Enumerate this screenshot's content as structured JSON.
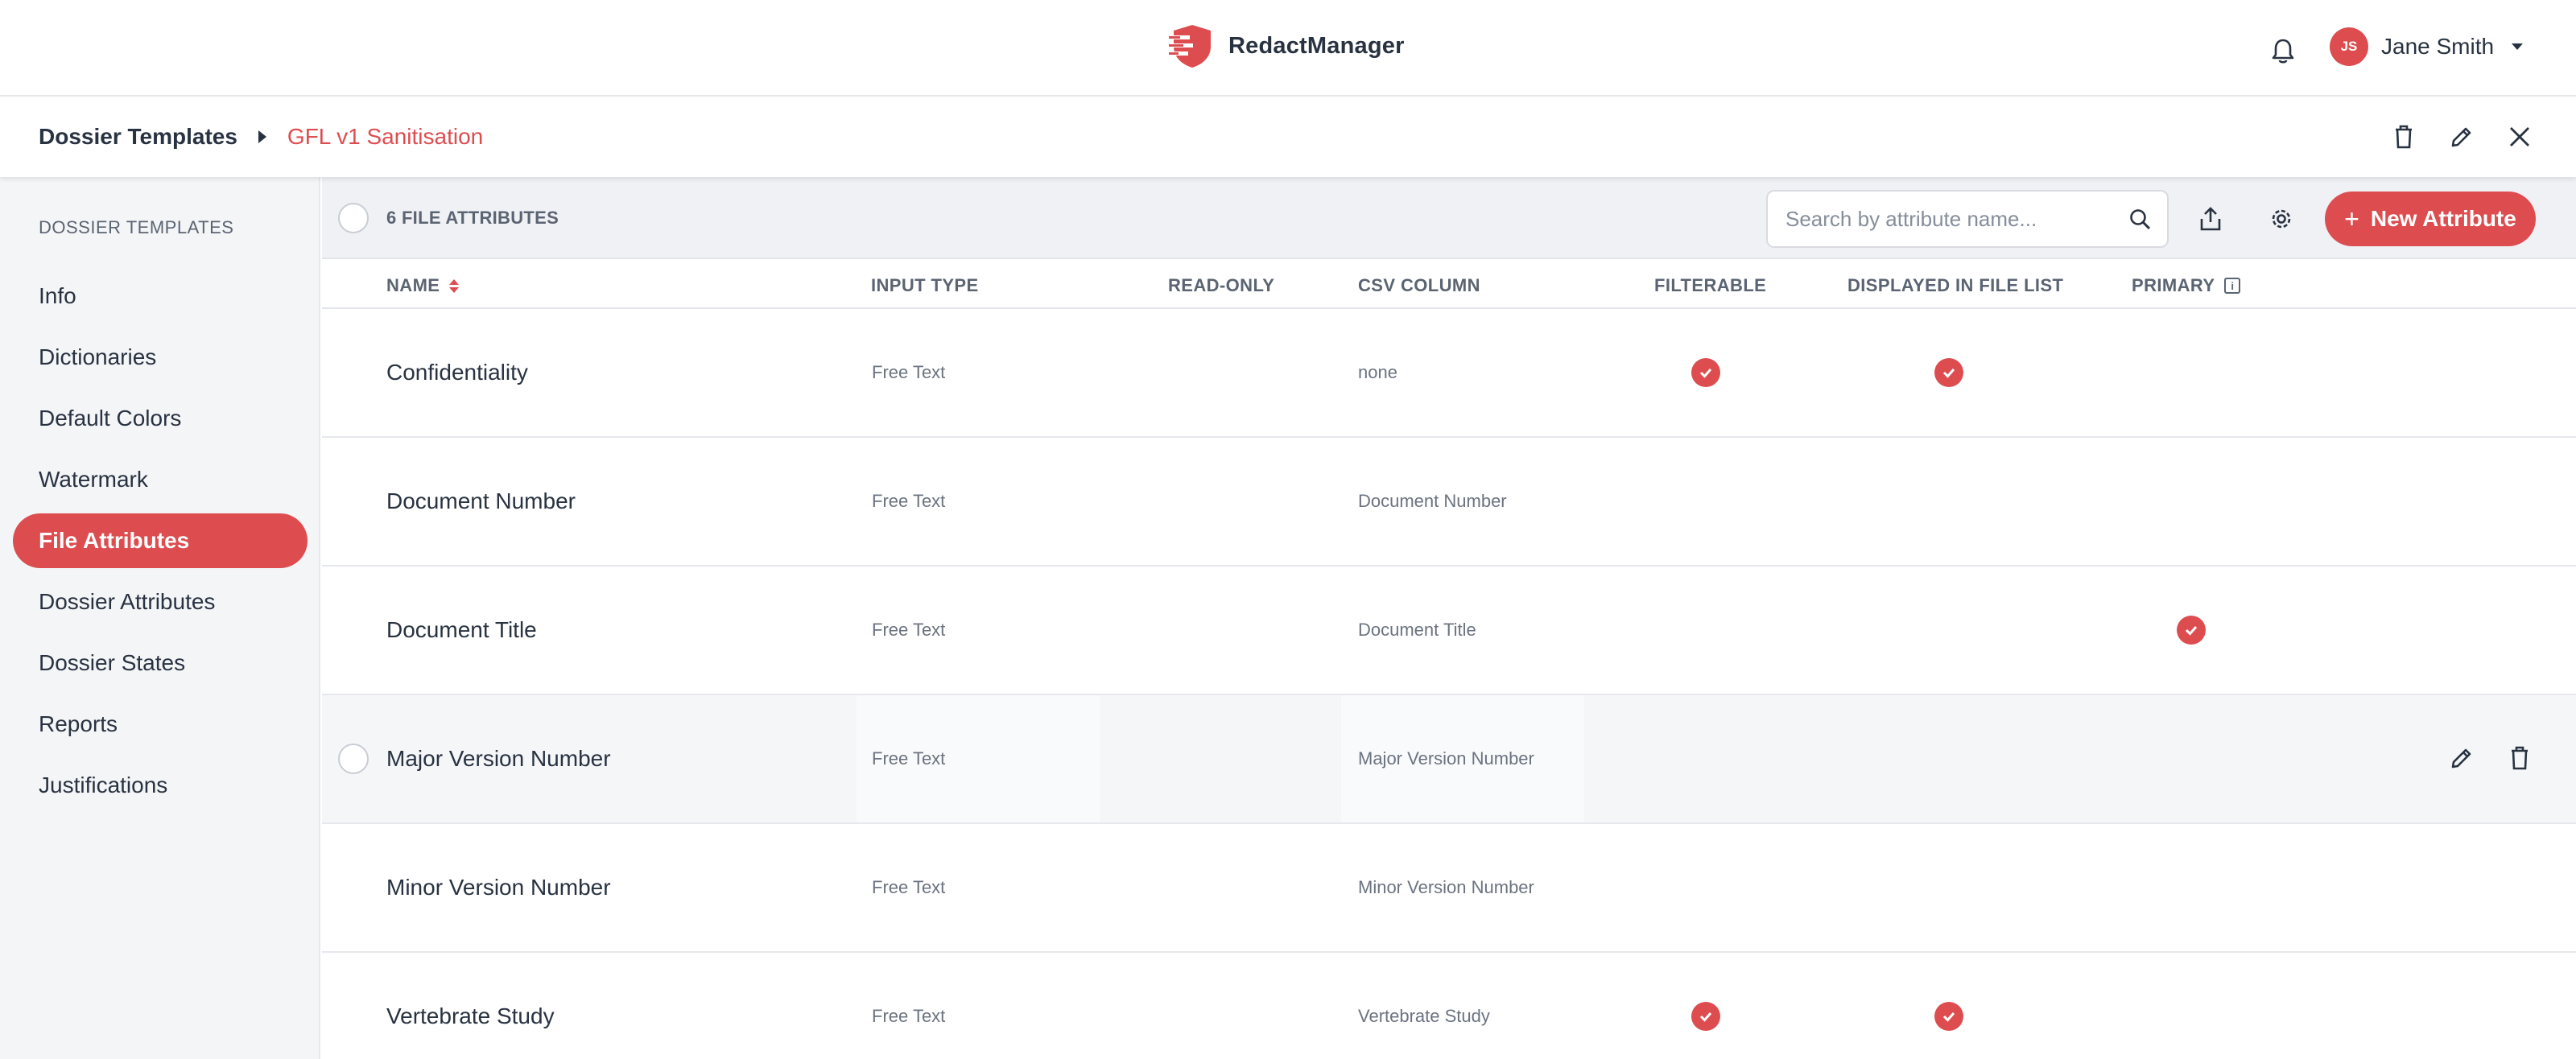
{
  "app": {
    "name": "RedactManager",
    "brand_color": "#dd4d50"
  },
  "user": {
    "initials": "JS",
    "name": "Jane Smith"
  },
  "breadcrumb": {
    "root": "Dossier Templates",
    "current": "GFL v1 Sanitisation"
  },
  "sidebar": {
    "heading": "DOSSIER TEMPLATES",
    "items": [
      {
        "label": "Info",
        "active": false
      },
      {
        "label": "Dictionaries",
        "active": false
      },
      {
        "label": "Default Colors",
        "active": false
      },
      {
        "label": "Watermark",
        "active": false
      },
      {
        "label": "File Attributes",
        "active": true
      },
      {
        "label": "Dossier Attributes",
        "active": false
      },
      {
        "label": "Dossier States",
        "active": false
      },
      {
        "label": "Reports",
        "active": false
      },
      {
        "label": "Justifications",
        "active": false
      }
    ]
  },
  "toolbar": {
    "count_label": "6 FILE ATTRIBUTES",
    "search_placeholder": "Search by attribute name...",
    "new_button": "New Attribute"
  },
  "table": {
    "columns": {
      "name": "NAME",
      "input_type": "INPUT TYPE",
      "read_only": "READ-ONLY",
      "csv_column": "CSV COLUMN",
      "filterable": "FILTERABLE",
      "displayed": "DISPLAYED IN FILE LIST",
      "primary": "PRIMARY"
    },
    "rows": [
      {
        "name": "Confidentiality",
        "input_type": "Free Text",
        "csv_column": "none",
        "filterable": true,
        "displayed": true,
        "primary": false
      },
      {
        "name": "Document Number",
        "input_type": "Free Text",
        "csv_column": "Document Number",
        "filterable": false,
        "displayed": false,
        "primary": false
      },
      {
        "name": "Document Title",
        "input_type": "Free Text",
        "csv_column": "Document Title",
        "filterable": false,
        "displayed": false,
        "primary": true
      },
      {
        "name": "Major Version Number",
        "input_type": "Free Text",
        "csv_column": "Major Version Number",
        "filterable": false,
        "displayed": false,
        "primary": false
      },
      {
        "name": "Minor Version Number",
        "input_type": "Free Text",
        "csv_column": "Minor Version Number",
        "filterable": false,
        "displayed": false,
        "primary": false
      },
      {
        "name": "Vertebrate Study",
        "input_type": "Free Text",
        "csv_column": "Vertebrate Study",
        "filterable": true,
        "displayed": true,
        "primary": false
      }
    ]
  }
}
